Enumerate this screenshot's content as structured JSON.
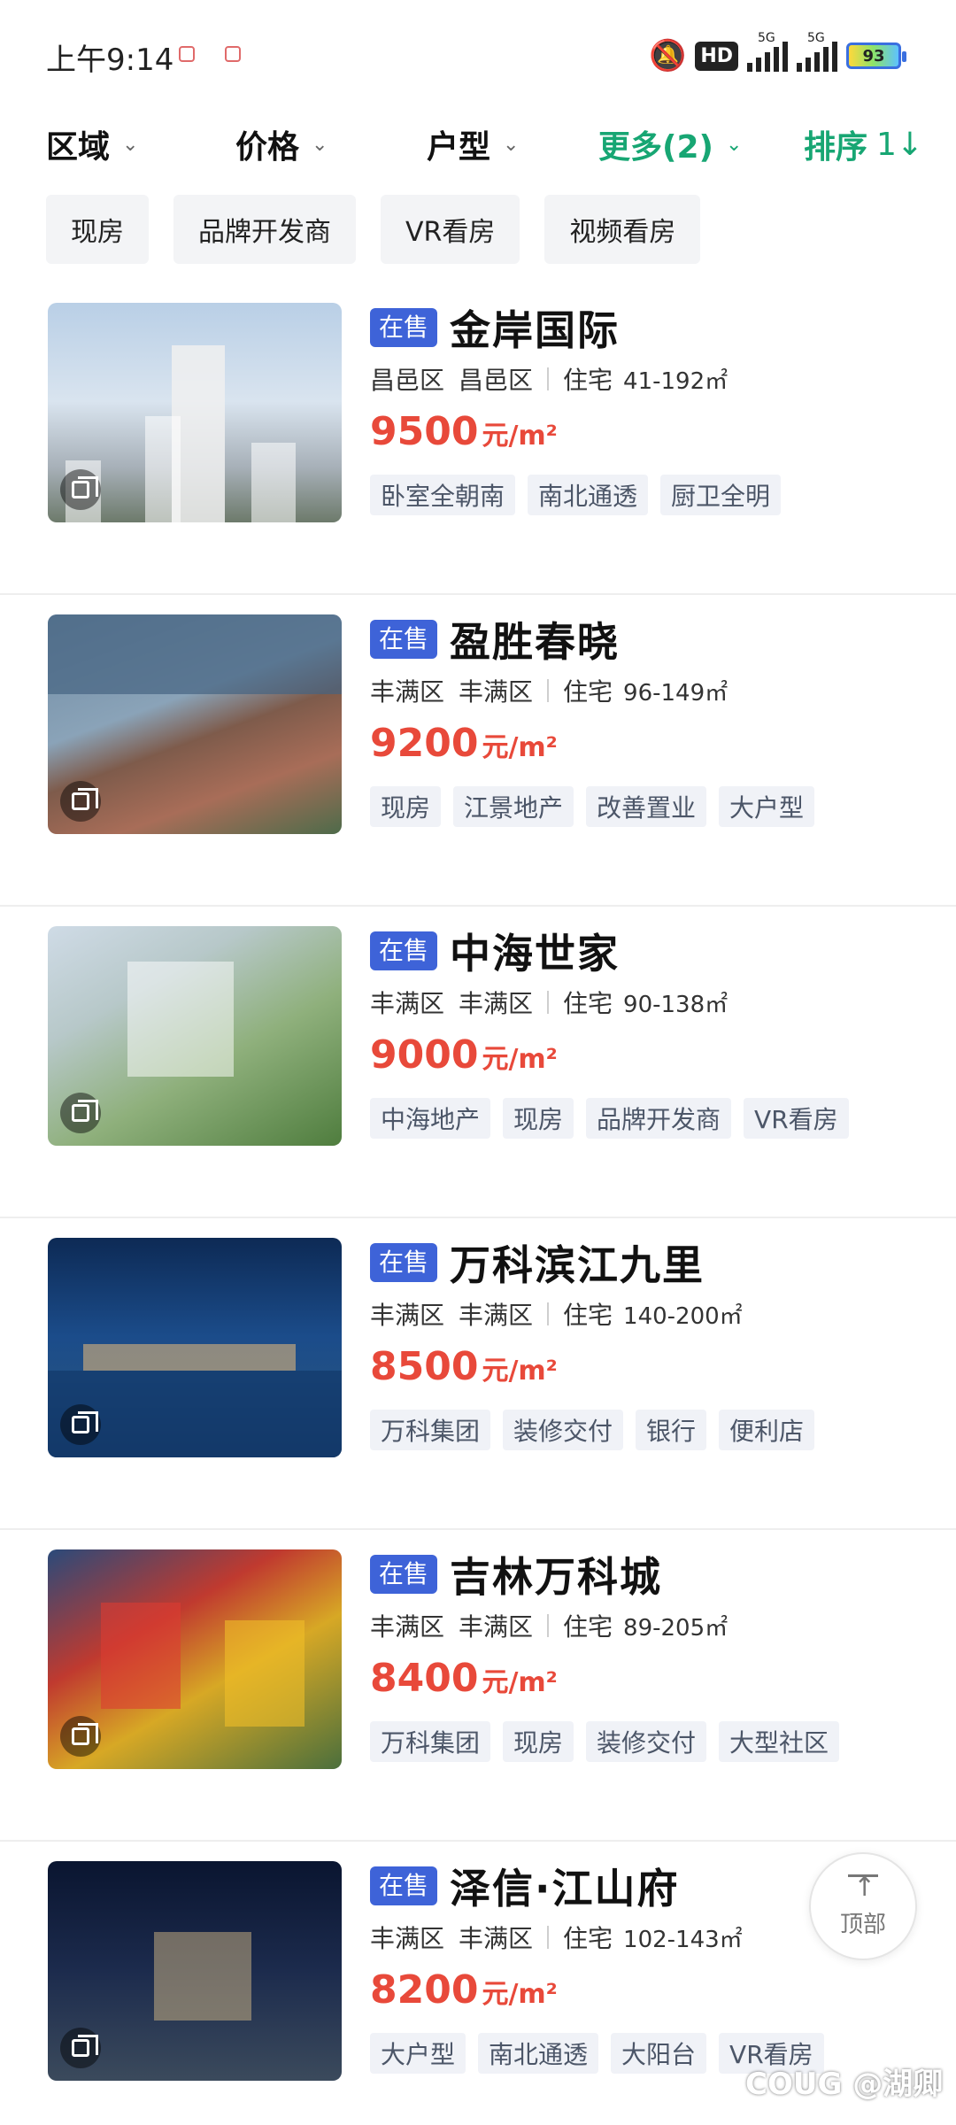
{
  "status_bar": {
    "time": "上午9:14",
    "hd": "HD",
    "network_1": "5G",
    "network_2": "5G",
    "battery": "93"
  },
  "filters": {
    "area": "区域",
    "price": "价格",
    "layout": "户型",
    "more": "更多(2)",
    "sort": "排序",
    "sort_icon": "1↓"
  },
  "quick_tags": [
    "现房",
    "品牌开发商",
    "VR看房",
    "视频看房"
  ],
  "listings": [
    {
      "status": "在售",
      "name": "金岸国际",
      "district": "昌邑区",
      "subdistrict": "昌邑区",
      "type": "住宅",
      "area": "41-192㎡",
      "price": "9500",
      "price_unit": "元/m²",
      "tags": [
        "卧室全朝南",
        "南北通透",
        "厨卫全明"
      ]
    },
    {
      "status": "在售",
      "name": "盈胜春晓",
      "district": "丰满区",
      "subdistrict": "丰满区",
      "type": "住宅",
      "area": "96-149㎡",
      "price": "9200",
      "price_unit": "元/m²",
      "tags": [
        "现房",
        "江景地产",
        "改善置业",
        "大户型"
      ]
    },
    {
      "status": "在售",
      "name": "中海世家",
      "district": "丰满区",
      "subdistrict": "丰满区",
      "type": "住宅",
      "area": "90-138㎡",
      "price": "9000",
      "price_unit": "元/m²",
      "tags": [
        "中海地产",
        "现房",
        "品牌开发商",
        "VR看房"
      ]
    },
    {
      "status": "在售",
      "name": "万科滨江九里",
      "district": "丰满区",
      "subdistrict": "丰满区",
      "type": "住宅",
      "area": "140-200㎡",
      "price": "8500",
      "price_unit": "元/m²",
      "tags": [
        "万科集团",
        "装修交付",
        "银行",
        "便利店"
      ]
    },
    {
      "status": "在售",
      "name": "吉林万科城",
      "district": "丰满区",
      "subdistrict": "丰满区",
      "type": "住宅",
      "area": "89-205㎡",
      "price": "8400",
      "price_unit": "元/m²",
      "tags": [
        "万科集团",
        "现房",
        "装修交付",
        "大型社区"
      ]
    },
    {
      "status": "在售",
      "name": "泽信·江山府",
      "district": "丰满区",
      "subdistrict": "丰满区",
      "type": "住宅",
      "area": "102-143㎡",
      "price": "8200",
      "price_unit": "元/m²",
      "tags": [
        "大户型",
        "南北通透",
        "大阳台",
        "VR看房"
      ]
    }
  ],
  "back_to_top": "顶部",
  "watermark": "COUG @湖卿",
  "colors": {
    "accent_green": "#17a673",
    "price_red": "#e8493a",
    "badge_blue": "#3e63d8"
  }
}
